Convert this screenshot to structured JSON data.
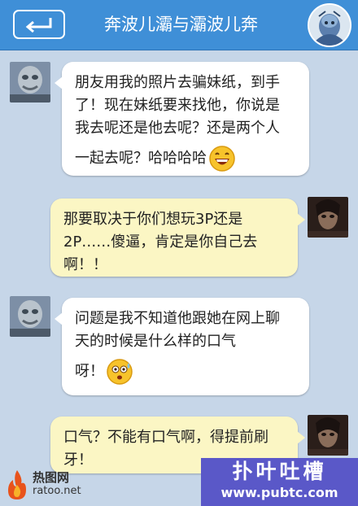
{
  "header": {
    "title": "奔波儿灞与灞波儿奔",
    "colors": {
      "bar": "#3f8fd7",
      "background": "#c6d6e8"
    }
  },
  "messages": [
    {
      "side": "left",
      "lines": [
        "朋友用我的照片去骗妹纸，到手",
        "了！现在妹纸要来找他，你说是",
        "我去呢还是他去呢？还是两个人",
        "一起去呢？哈哈哈哈"
      ],
      "emoji": "grinning-emoji"
    },
    {
      "side": "right",
      "lines": [
        "那要取决于你们想玩3P还是",
        "2P……傻逼，肯定是你自己去",
        "啊！！"
      ]
    },
    {
      "side": "left",
      "lines": [
        "问题是我不知道他跟她在网上聊",
        "天的时候是什么样的口气",
        "呀！"
      ],
      "emoji": "sweating-emoji"
    },
    {
      "side": "right",
      "lines": [
        "口气？不能有口气啊，得提前刷",
        "牙！"
      ]
    }
  ],
  "watermark_left": {
    "name": "热图网",
    "url": "ratoo.net"
  },
  "watermark_right": {
    "name": "扑叶吐槽",
    "url": "www.pubtc.com"
  }
}
